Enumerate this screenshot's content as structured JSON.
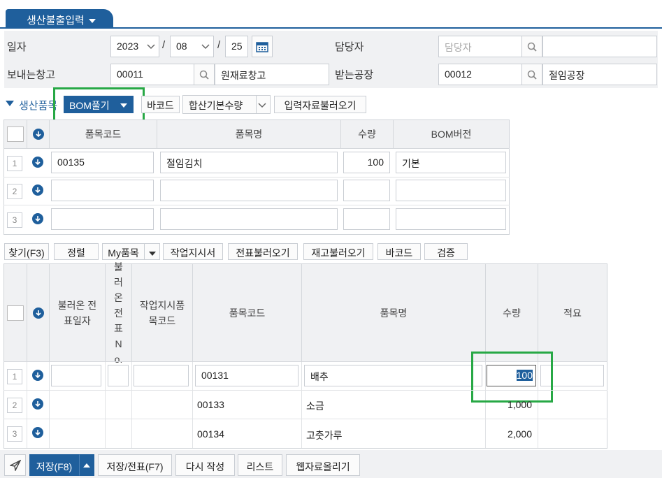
{
  "tab": {
    "title": "생산불출입력"
  },
  "form": {
    "date_label": "일자",
    "year": "2023",
    "month": "08",
    "day": "25",
    "date_sep": "/",
    "manager_label": "담당자",
    "manager_placeholder": "담당자",
    "send_wh_label": "보내는창고",
    "send_wh_code": "00011",
    "send_wh_name": "원재료창고",
    "recv_label": "받는공장",
    "recv_code": "00012",
    "recv_name": "절임공장"
  },
  "production_section": {
    "title": "생산품목",
    "bom_button": "BOM풀기",
    "barcode_button": "바코드",
    "sum_select": "합산기본수량",
    "load_button": "입력자료불러오기"
  },
  "top_grid": {
    "headers": [
      "품목코드",
      "품목명",
      "수량",
      "BOM버전"
    ],
    "rows": [
      {
        "no": "1",
        "code": "00135",
        "name": "절임김치",
        "qty": "100",
        "bom": "기본"
      },
      {
        "no": "2",
        "code": "",
        "name": "",
        "qty": "",
        "bom": ""
      },
      {
        "no": "3",
        "code": "",
        "name": "",
        "qty": "",
        "bom": ""
      }
    ]
  },
  "toolbar": {
    "find": "찾기(F3)",
    "sort": "정렬",
    "my_item": "My품목",
    "work_order": "작업지시서",
    "slip_load": "전표불러오기",
    "stock_load": "재고불러오기",
    "barcode": "바코드",
    "verify": "검증"
  },
  "bottom_grid": {
    "headers": {
      "loaded_date": "불러온 전표일자",
      "loaded_no": "불러온전표No.",
      "work_code": "작업지시품목코드",
      "code": "품목코드",
      "name": "품목명",
      "qty": "수량",
      "memo": "적요"
    },
    "rows": [
      {
        "no": "1",
        "code": "00131",
        "name": "배추",
        "qty": "100"
      },
      {
        "no": "2",
        "code": "00133",
        "name": "소금",
        "qty": "1,000"
      },
      {
        "no": "3",
        "code": "00134",
        "name": "고춧가루",
        "qty": "2,000"
      }
    ]
  },
  "footer": {
    "save": "저장(F8)",
    "save_slip": "저장/전표(F7)",
    "rewrite": "다시 작성",
    "list": "리스트",
    "web_upload": "웹자료올리기"
  },
  "colors": {
    "accent": "#1f5f9c",
    "highlight": "#27a845"
  }
}
